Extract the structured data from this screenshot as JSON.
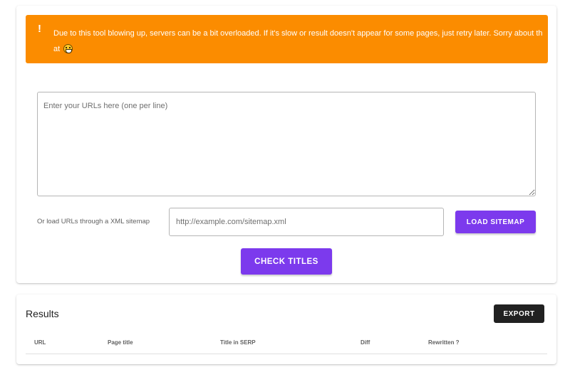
{
  "alert": {
    "icon": "!",
    "message": "Due to this tool blowing up, servers can be a bit overloaded. If it's slow or result doesn't appear for some pages, just retry later. Sorry about that",
    "emoji_icon": "grinning-sweat-face-icon",
    "color": "#fb8c00"
  },
  "urls_input": {
    "placeholder": "Enter your URLs here (one per line)",
    "value": ""
  },
  "sitemap": {
    "label": "Or load URLs through a XML sitemap",
    "placeholder": "http://example.com/sitemap.xml",
    "value": "",
    "button_label": "LOAD SITEMAP"
  },
  "check_button_label": "CHECK TITLES",
  "accent_color": "#7c3aed",
  "results": {
    "title": "Results",
    "export_label": "EXPORT",
    "columns": [
      "URL",
      "Page title",
      "Title in SERP",
      "Diff",
      "Rewritten ?"
    ]
  }
}
